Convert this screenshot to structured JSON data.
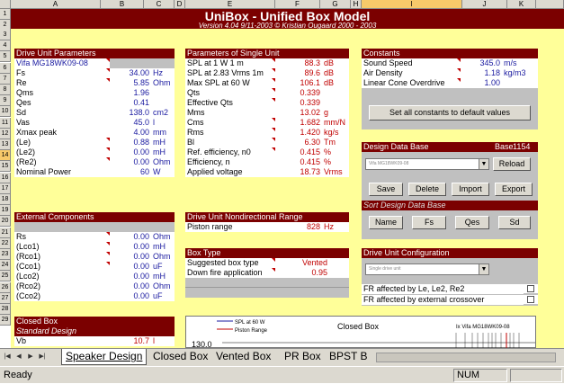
{
  "columns": [
    "A",
    "B",
    "C",
    "D",
    "E",
    "F",
    "G",
    "H",
    "I",
    "J",
    "K"
  ],
  "rows": [
    "1",
    "2",
    "3",
    "4",
    "5",
    "6",
    "7",
    "8",
    "9",
    "10",
    "11",
    "12",
    "13",
    "14",
    "15",
    "16",
    "17",
    "18",
    "19",
    "20",
    "21",
    "22",
    "23",
    "24",
    "25",
    "26",
    "27",
    "28",
    "29"
  ],
  "title": "UniBox  -  Unified Box Model",
  "version_line": "Version 4.04  9/11-2003        ©  Kristian Ougaard  2000 - 2003",
  "drive_unit_params": {
    "header": "Drive Unit Parameters",
    "model": "Vifa MG18WK09-08",
    "rows": [
      {
        "label": "Fs",
        "value": "34.00",
        "unit": "Hz"
      },
      {
        "label": "Re",
        "value": "5.85",
        "unit": "Ohm"
      },
      {
        "label": "Qms",
        "value": "1.96",
        "unit": ""
      },
      {
        "label": "Qes",
        "value": "0.41",
        "unit": ""
      },
      {
        "label": "Sd",
        "value": "138.0",
        "unit": "cm2"
      },
      {
        "label": "Vas",
        "value": "45.0",
        "unit": "l"
      },
      {
        "label": "Xmax peak",
        "value": "4.00",
        "unit": "mm"
      },
      {
        "label": "(Le)",
        "value": "0.88",
        "unit": "mH"
      },
      {
        "label": "(Le2)",
        "value": "0.00",
        "unit": "mH"
      },
      {
        "label": "(Re2)",
        "value": "0.00",
        "unit": "Ohm"
      },
      {
        "label": "Nominal Power",
        "value": "60",
        "unit": "W"
      }
    ]
  },
  "external_components": {
    "header": "External Components",
    "rows": [
      {
        "label": "Rs",
        "value": "0.00",
        "unit": "Ohm"
      },
      {
        "label": "(Lco1)",
        "value": "0.00",
        "unit": "mH"
      },
      {
        "label": "(Rco1)",
        "value": "0.00",
        "unit": "Ohm"
      },
      {
        "label": "(Cco1)",
        "value": "0.00",
        "unit": "uF"
      },
      {
        "label": "(Lco2)",
        "value": "0.00",
        "unit": "mH"
      },
      {
        "label": "(Rco2)",
        "value": "0.00",
        "unit": "Ohm"
      },
      {
        "label": "(Cco2)",
        "value": "0.00",
        "unit": "uF"
      }
    ]
  },
  "closed_box": {
    "header": "Closed Box",
    "subheader": "Standard Design",
    "rows": [
      {
        "label": "Vb",
        "value": "10.7",
        "unit": "l"
      }
    ]
  },
  "single_unit_params": {
    "header": "Parameters of Single Unit",
    "rows": [
      {
        "label": "SPL at 1 W 1 m",
        "value": "88.3",
        "unit": "dB"
      },
      {
        "label": "SPL at 2.83 Vrms 1m",
        "value": "89.6",
        "unit": "dB"
      },
      {
        "label": "Max SPL at 60 W",
        "value": "106.1",
        "unit": "dB"
      },
      {
        "label": "Qts",
        "value": "0.339",
        "unit": ""
      },
      {
        "label": "Effective Qts",
        "value": "0.339",
        "unit": ""
      },
      {
        "label": "Mms",
        "value": "13.02",
        "unit": "g"
      },
      {
        "label": "Cms",
        "value": "1.682",
        "unit": "mm/N"
      },
      {
        "label": "Rms",
        "value": "1.420",
        "unit": "kg/s"
      },
      {
        "label": "Bl",
        "value": "6.30",
        "unit": "Tm"
      },
      {
        "label": "Ref. efficiency, n0",
        "value": "0.415",
        "unit": "%"
      },
      {
        "label": "Efficiency, n",
        "value": "0.415",
        "unit": "%"
      },
      {
        "label": "Applied voltage",
        "value": "18.73",
        "unit": "Vrms"
      }
    ]
  },
  "nondirectional": {
    "header": "Drive Unit Nondirectional Range",
    "rows": [
      {
        "label": "Piston range",
        "value": "828",
        "unit": "Hz"
      }
    ]
  },
  "box_type": {
    "header": "Box Type",
    "rows": [
      {
        "label": "Suggested box type",
        "value": "Vented"
      },
      {
        "label": "Down fire application",
        "value": "0.95"
      }
    ]
  },
  "constants": {
    "header": "Constants",
    "rows": [
      {
        "label": "Sound Speed",
        "value": "345.0",
        "unit": "m/s"
      },
      {
        "label": "Air Density",
        "value": "1.18",
        "unit": "kg/m3"
      },
      {
        "label": "Linear Cone Overdrive",
        "value": "1.00",
        "unit": ""
      }
    ],
    "reset_button": "Set all constants to default values"
  },
  "design_db": {
    "header": "Design Data Base",
    "base_label": "Base",
    "base_count": "1154",
    "selected": "Vifa MG18WK09-08",
    "reload": "Reload",
    "save": "Save",
    "delete": "Delete",
    "import": "Import",
    "export": "Export",
    "sort_header": "Sort Design Data Base",
    "sort_name": "Name",
    "sort_fs": "Fs",
    "sort_qes": "Qes",
    "sort_sd": "Sd"
  },
  "drive_config": {
    "header": "Drive Unit Configuration",
    "selected": "Single drive unit",
    "check1": "FR affected by Le, Le2, Re2",
    "check2": "FR affected by external crossover"
  },
  "chart": {
    "legend1": "SPL at 60 W",
    "legend2": "Piston Range",
    "title": "Closed Box",
    "model": "Ix Vifa MG18WK09-08",
    "ytick": "130.0"
  },
  "tabs": [
    "Speaker Design",
    "Closed Box",
    "Vented Box",
    "PR Box",
    "BPST B"
  ],
  "status": {
    "ready": "Ready",
    "num": "NUM"
  },
  "colors": {
    "header_bg": "#7b0000",
    "sheet_bg": "#ffff99",
    "value_blue": "#1a1aa0",
    "value_red": "#c00000"
  }
}
